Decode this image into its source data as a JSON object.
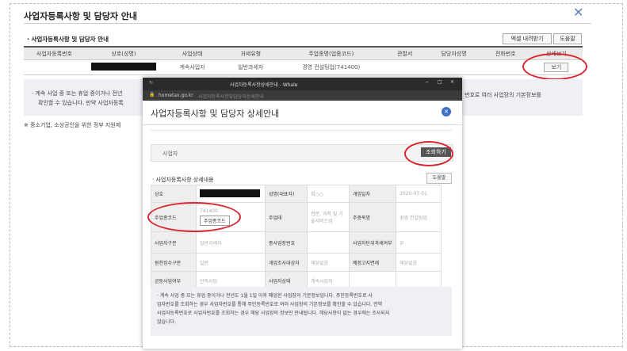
{
  "page": {
    "title": "사업자등록사항 및 담당자 안내",
    "close_symbol": "✕",
    "section_title": "· 사업자등록사항 및 담당자 안내",
    "excel_button": "엑셀 내려받기",
    "help_button": "도움말",
    "table": {
      "headers": [
        "사업자등록번호",
        "상호(성명)",
        "사업상태",
        "과세유형",
        "주업종명(업종코드)",
        "관할서",
        "담당자성명",
        "전화번호",
        "상세보기"
      ],
      "row": {
        "status": "계속사업자",
        "tax_type": "일반과세자",
        "industry": "경영 컨설팅업(741400)",
        "view_button": "보기"
      }
    },
    "notice_lines": [
      "· 계속 사업 중 또는 휴업 중이거나 전년",
      "확인할 수 있습니다. 만약 사업자등록",
      "번호로 여러 사업장의 기본정보를"
    ],
    "side_note": "※ 중소기업, 소상공인을 위한 정부 지원제"
  },
  "popup": {
    "window_title": "사업자등록사항상세안내 - Whale",
    "url": "hometax.go.kr",
    "url_rest": "사업자등록사항및담당자상세안내",
    "title": "사업자등록사항 및 담당자 상세안내",
    "close_symbol": "×",
    "search_label": "사업자",
    "search_button": "조회하기",
    "section_title": "· 사업자등록사항 상세내용",
    "print_button": "도움말",
    "rows": [
      [
        {
          "l": "상호",
          "v": ""
        },
        {
          "l": "성명(대표자)",
          "v": "최○○"
        },
        {
          "l": "개업일자",
          "v": "2020-07-01"
        }
      ],
      [
        {
          "l": "주업종코드",
          "v": "741400"
        },
        {
          "l": "주업태",
          "v": "전문, 과학 및 기술서비스업"
        },
        {
          "l": "주종목명",
          "v": "경영 컨설팅업"
        }
      ],
      [
        {
          "l": "사업자구분",
          "v": "일반과세자"
        },
        {
          "l": "종사업장번호",
          "v": ""
        },
        {
          "l": "사업자단위과세여부",
          "v": "부"
        }
      ],
      [
        {
          "l": "원천징수구분",
          "v": "일반"
        },
        {
          "l": "개업조사대상자",
          "v": "해당없음"
        },
        {
          "l": "예정고지면제",
          "v": "해당없음"
        }
      ],
      [
        {
          "l": "공동사업여부",
          "v": "단독사업"
        },
        {
          "l": "사업자상태",
          "v": "계속사업자"
        },
        {
          "l": "",
          "v": ""
        }
      ]
    ],
    "code_button": "주업종코드",
    "notice_lines": [
      "· 계속 사업 중 또는 휴업 중이거나 전년도 1월 1일 이후 폐업한 사업장의 기본정보입니다. 주민등록번호로 사",
      "  업자번호를 조회하는 경우 사업자번호를 통해 주민등록번호로 여러 사업장의 기본정보를 확인할 수 있습니다. 만약",
      "  사업자등록번호로 사업자번호를 조회하는 경우 해당 사업장의 정보만 안내됩니다. 해당사항이 없는 경우에는 조사되지",
      "  않습니다."
    ]
  },
  "colors": {
    "accent": "#3e6fc4",
    "highlight": "#d9252f"
  }
}
